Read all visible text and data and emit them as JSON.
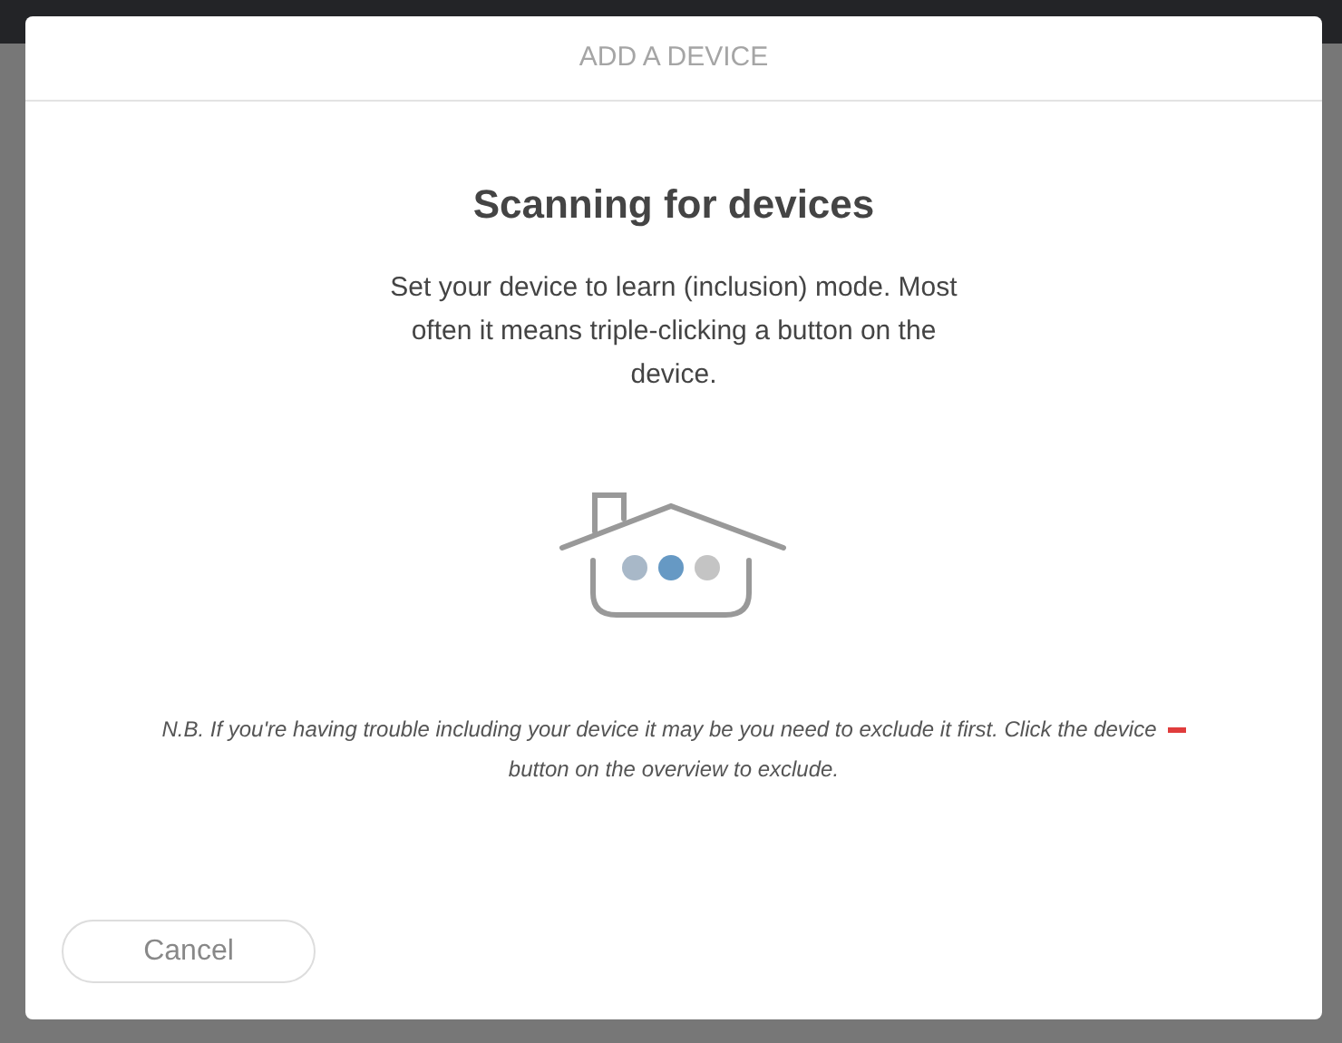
{
  "dialog": {
    "title": "ADD A DEVICE",
    "heading": "Scanning for devices",
    "instructions": "Set your device to learn (inclusion) mode. Most often it means triple-clicking a button on the device.",
    "note": {
      "text_before_icon": "N.B. If you're having trouble including your device it may be you need to exclude it first. Click the device",
      "text_after_icon": "button on the overview to exclude."
    },
    "buttons": [
      "Cancel"
    ]
  }
}
